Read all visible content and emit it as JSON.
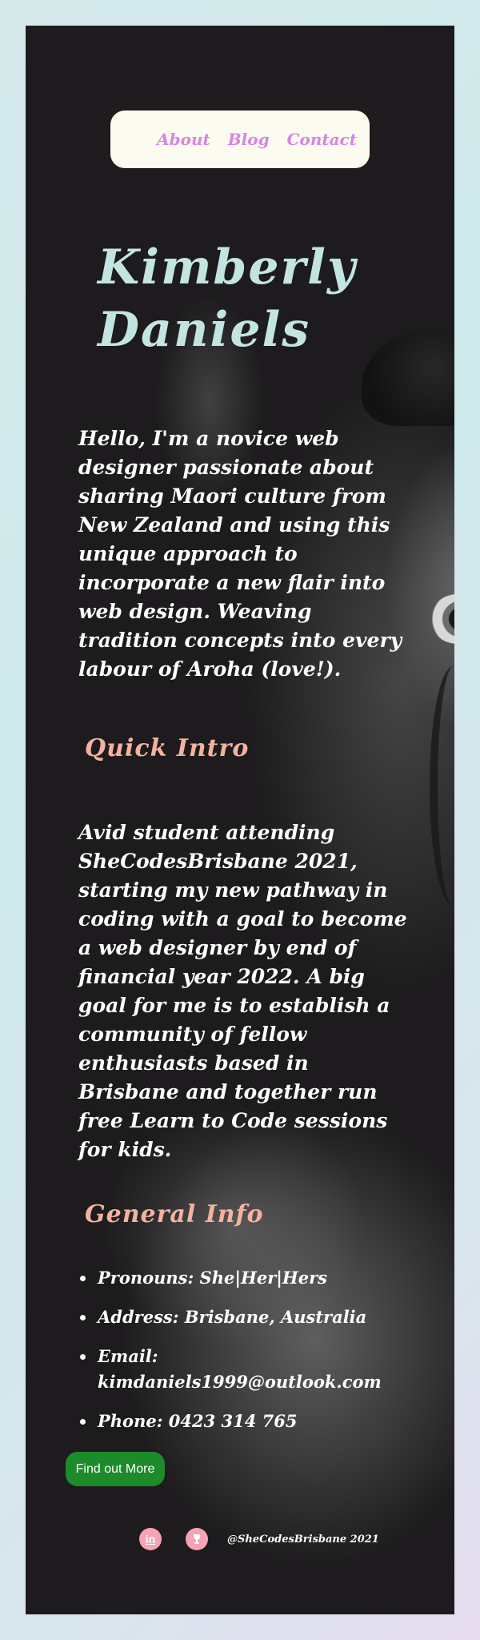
{
  "nav": {
    "about": "About",
    "blog": "Blog",
    "contact": "Contact"
  },
  "hero": {
    "title": "Kimberly Daniels",
    "intro": "Hello, I'm a novice web designer passionate about sharing Maori culture from New Zealand and using this unique approach to incorporate a new flair into web design. Weaving tradition concepts into every labour of Aroha (love!)."
  },
  "quick_intro": {
    "heading": "Quick Intro",
    "text": "Avid student attending SheCodesBrisbane 2021, starting my new pathway in coding with a goal to become a web designer by end of financial year 2022. A big goal for me is to establish a community of fellow enthusiasts based in Brisbane and together run free Learn to Code sessions for kids."
  },
  "general_info": {
    "heading": "General Info",
    "items": [
      "Pronouns: She|Her|Hers",
      "Address: Brisbane, Australia",
      "Email: kimdaniels1999@outlook.com",
      "Phone: 0423 314 765"
    ]
  },
  "cta": {
    "label": "Find out More"
  },
  "footer": {
    "linkedin_icon": "linkedin-icon",
    "trophy_icon": "trophy-icon",
    "linkedin_glyph": "in",
    "credit": "@SheCodesBrisbane 2021"
  },
  "colors": {
    "background": "#1d1b1d",
    "nav_bg": "#fcfbef",
    "nav_link": "#d784e6",
    "title": "#c3e5e2",
    "section_heading": "#f2b39e",
    "button": "#1d8b2a",
    "social_icon": "#f6a3b4"
  }
}
